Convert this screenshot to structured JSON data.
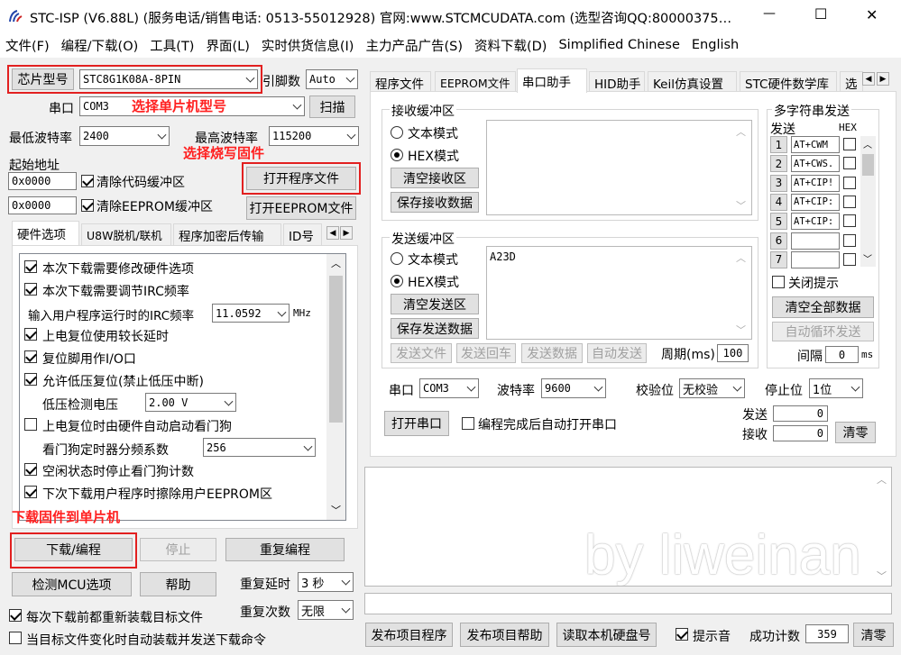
{
  "window": {
    "title": "STC-ISP (V6.88L) (服务电话/销售电话: 0513-55012928) 官网:www.STCMCUDATA.com  (选型咨询QQ:80000375…",
    "minimize": "—",
    "maximize": "☐",
    "close": "✕"
  },
  "menu": [
    "文件(F)",
    "编程/下载(O)",
    "工具(T)",
    "界面(L)",
    "实时供货信息(I)",
    "主力产品广告(S)",
    "资料下载(D)",
    "Simplified Chinese",
    "English"
  ],
  "left": {
    "chip_label": "芯片型号",
    "chip_value": "STC8G1K08A-8PIN",
    "pin_label": "引脚数",
    "pin_value": "Auto",
    "port_label": "串口",
    "port_value": "COM3",
    "scan_button": "扫描",
    "min_baud_label": "最低波特率",
    "min_baud_value": "2400",
    "max_baud_label": "最高波特率",
    "max_baud_value": "115200",
    "start_addr_label": "起始地址",
    "addr1": "0x0000",
    "clear_code": "清除代码缓冲区",
    "open_program": "打开程序文件",
    "addr2": "0x0000",
    "clear_eeprom": "清除EEPROM缓冲区",
    "open_eeprom": "打开EEPROM文件",
    "tabs": [
      "硬件选项",
      "U8W脱机/联机",
      "程序加密后传输",
      "ID号"
    ],
    "options": [
      {
        "label": "本次下载需要修改硬件选项",
        "checked": true
      },
      {
        "label": "本次下载需要调节IRC频率",
        "checked": true
      },
      {
        "label": "上电复位使用较长延时",
        "checked": true
      },
      {
        "label": "复位脚用作I/O口",
        "checked": true
      },
      {
        "label": "允许低压复位(禁止低压中断)",
        "checked": true
      },
      {
        "label": "上电复位时由硬件自动启动看门狗",
        "checked": false
      },
      {
        "label": "空闲状态时停止看门狗计数",
        "checked": true
      },
      {
        "label": "下次下载用户程序时擦除用户EEPROM区",
        "checked": true
      }
    ],
    "irc_label": "输入用户程序运行时的IRC频率",
    "irc_value": "11.0592",
    "irc_unit": "MHz",
    "lvd_label": "低压检测电压",
    "lvd_value": "2.00 V",
    "wdt_label": "看门狗定时器分频系数",
    "wdt_value": "256",
    "download_button": "下载/编程",
    "stop_button": "停止",
    "reprogram_button": "重复编程",
    "detect_button": "检测MCU选项",
    "help_button": "帮助",
    "repeat_delay_label": "重复延时",
    "repeat_delay_value": "3 秒",
    "repeat_count_label": "重复次数",
    "repeat_count_value": "无限",
    "reload_label": "每次下载前都重新装载目标文件",
    "reload_checked": true,
    "auto_label": "当目标文件变化时自动装载并发送下载命令",
    "auto_checked": false
  },
  "annotations": {
    "select_chip": "选择单片机型号",
    "select_firmware": "选择烧写固件",
    "download_firmware": "下载固件到单片机"
  },
  "right": {
    "tabs": [
      "程序文件",
      "EEPROM文件",
      "串口助手",
      "HID助手",
      "Keil仿真设置",
      "STC硬件数学库",
      "选"
    ],
    "recv_group": "接收缓冲区",
    "recv_text_mode": "文本模式",
    "recv_hex_mode": "HEX模式",
    "clear_recv": "清空接收区",
    "save_recv": "保存接收数据",
    "send_group": "发送缓冲区",
    "send_text_mode": "文本模式",
    "send_hex_mode": "HEX模式",
    "send_content": "A23D",
    "clear_send": "清空发送区",
    "save_send": "保存发送数据",
    "send_file": "发送文件",
    "send_enter": "发送回车",
    "send_data": "发送数据",
    "auto_send": "自动发送",
    "period_label": "周期(ms)",
    "period_value": "100",
    "multi_title": "多字符串发送",
    "multi_send_col": "发送",
    "multi_hex_col": "HEX",
    "multi_rows": [
      {
        "n": "1",
        "v": "AT+CWM"
      },
      {
        "n": "2",
        "v": "AT+CWS."
      },
      {
        "n": "3",
        "v": "AT+CIP!"
      },
      {
        "n": "4",
        "v": "AT+CIP:"
      },
      {
        "n": "5",
        "v": "AT+CIP:"
      },
      {
        "n": "6",
        "v": ""
      },
      {
        "n": "7",
        "v": ""
      }
    ],
    "close_hint": "关闭提示",
    "clear_all": "清空全部数据",
    "auto_loop": "自动循环发送",
    "interval_label": "间隔",
    "interval_value": "0",
    "interval_unit": "ms",
    "port_label": "串口",
    "port_value": "COM3",
    "baud_label": "波特率",
    "baud_value": "9600",
    "parity_label": "校验位",
    "parity_value": "无校验",
    "stopbit_label": "停止位",
    "stopbit_value": "1位",
    "open_port": "打开串口",
    "auto_open": "编程完成后自动打开串口",
    "sent_label": "发送",
    "sent_value": "0",
    "recv_label": "接收",
    "recv_value": "0",
    "clear_count": "清零",
    "watermark": "by liweinan",
    "publish_program": "发布项目程序",
    "publish_help": "发布项目帮助",
    "read_disk": "读取本机硬盘号",
    "beep_label": "提示音",
    "beep_checked": true,
    "success_label": "成功计数",
    "success_value": "359",
    "clear_success": "清零"
  }
}
